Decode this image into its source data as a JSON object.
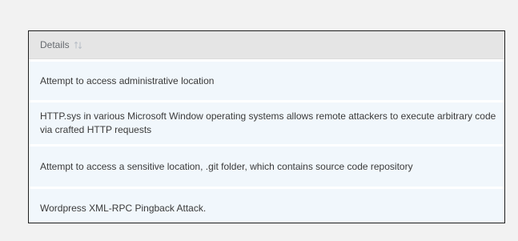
{
  "table": {
    "header": {
      "column_label": "Details",
      "sort_icon": "sort-arrows-icon"
    },
    "rows": [
      {
        "details": "Attempt to access administrative location"
      },
      {
        "details": "HTTP.sys in various Microsoft Window operating systems allows remote attackers to execute arbitrary code via crafted HTTP requests"
      },
      {
        "details": "Attempt to access a sensitive location, .git folder, which contains source code repository"
      },
      {
        "details": "Wordpress XML-RPC Pingback Attack."
      }
    ]
  },
  "colors": {
    "header_bg": "#e5e5e5",
    "row_bg": "#f1f7fc",
    "page_bg": "#f2f2f2",
    "border": "#1f1f1f",
    "text": "#3a3a3a",
    "header_text": "#666a6f"
  }
}
